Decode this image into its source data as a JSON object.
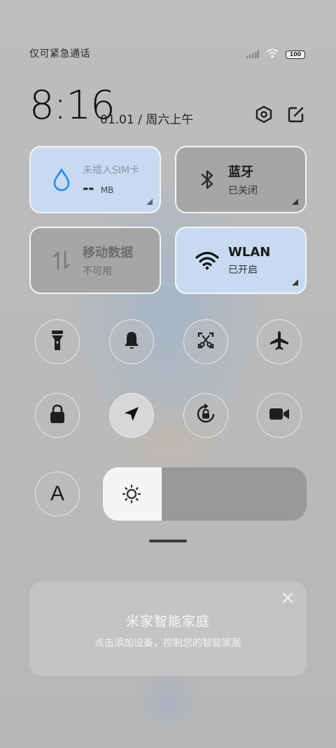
{
  "status_bar": {
    "carrier_text": "仅可紧急通话",
    "battery_level": "100",
    "icons": [
      "signal-icon",
      "wifi-icon",
      "battery-icon"
    ]
  },
  "header": {
    "time": "8:16",
    "date": "01.01 / 周六上午",
    "settings_icon": "settings-hexagon-icon",
    "edit_icon": "edit-icon"
  },
  "tiles": [
    {
      "name": "data-usage",
      "title": "未插入SIM卡",
      "value": "--",
      "unit": "MB",
      "state": "on",
      "icon": "water-drop-icon"
    },
    {
      "name": "bluetooth",
      "title": "蓝牙",
      "subtitle": "已关闭",
      "state": "off",
      "icon": "bluetooth-icon"
    },
    {
      "name": "mobile-data",
      "title": "移动数据",
      "subtitle": "不可用",
      "state": "disabled",
      "icon": "mobile-data-icon"
    },
    {
      "name": "wlan",
      "title": "WLAN",
      "subtitle": "已开启",
      "state": "on",
      "icon": "wifi-icon"
    }
  ],
  "toggles_row1": [
    "flashlight-icon",
    "bell-icon",
    "screenshot-icon",
    "airplane-icon"
  ],
  "toggles_row2": [
    "lock-icon",
    "location-icon",
    "rotation-lock-icon",
    "screen-record-icon"
  ],
  "font_toggle": {
    "label": "A"
  },
  "brightness": {
    "level": 0.29,
    "icon": "brightness-icon"
  },
  "colors": {
    "tile_on": "#c7daf2",
    "tile_off": "#a6a6a6",
    "accent_blue": "#2a8ee0"
  },
  "smart_home": {
    "title": "米家智能家庭",
    "subtitle": "点击添加设备，控制您的智能家居",
    "close_icon": "close-icon"
  }
}
